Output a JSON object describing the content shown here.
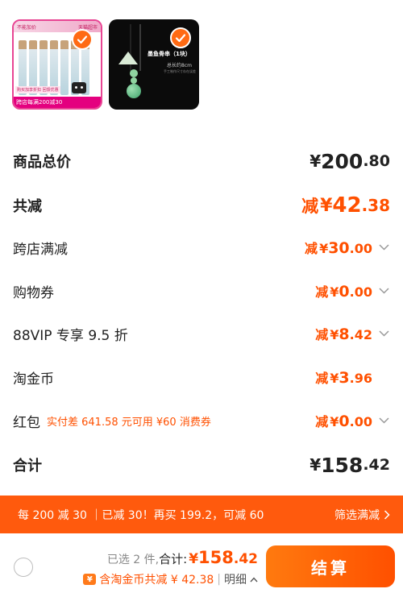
{
  "products": [
    {
      "top_left": "不能加价",
      "top_right": "天猫超市",
      "band": "购买加享折扣 回馈优惠",
      "promo": "跨店每满200减30",
      "selected": true
    },
    {
      "title": "墨鱼骨串（1块）",
      "subtitle": "总长约8cm",
      "note": "手工制作尺寸存在误差",
      "selected": true
    }
  ],
  "summary": {
    "goods_total": {
      "label": "商品总价",
      "currency": "¥",
      "int": "200",
      "dec": ".80"
    },
    "total_reduction": {
      "label": "共减",
      "prefix": "减",
      "currency": "¥",
      "int": "42",
      "dec": ".38"
    },
    "cross_store": {
      "label": "跨店满减",
      "prefix": "减",
      "currency": "¥",
      "int": "30",
      "dec": ".00"
    },
    "coupon": {
      "label": "购物券",
      "prefix": "减",
      "currency": "¥",
      "int": "0",
      "dec": ".00"
    },
    "vip": {
      "label": "88VIP 专享 9.5 折",
      "prefix": "减",
      "currency": "¥",
      "int": "8",
      "dec": ".42"
    },
    "gold_coin": {
      "label": "淘金币",
      "prefix": "减",
      "currency": "¥",
      "int": "3",
      "dec": ".96"
    },
    "red_packet": {
      "label": "红包",
      "note": "实付差 641.58 元可用 ¥60 消费券",
      "prefix": "减",
      "currency": "¥",
      "int": "0",
      "dec": ".00"
    },
    "total": {
      "label": "合计",
      "currency": "¥",
      "int": "158",
      "dec": ".42"
    }
  },
  "promo_bar": {
    "text": "每 200 减 30 ｜已减 30！再买 199.2，可减 60",
    "filter": "筛选满减"
  },
  "footer": {
    "selected": "已选 2 件,",
    "total_label": "合计:",
    "currency": "¥",
    "int": "158",
    "dec": ".42",
    "coin_icon": "¥",
    "coin_text": "含淘金币共减 ¥ 42.38",
    "divider": "|",
    "detail": "明细",
    "checkout": "结算"
  },
  "colors": {
    "accent": "#ff5000",
    "promo_bg": "#ff5a0d"
  }
}
